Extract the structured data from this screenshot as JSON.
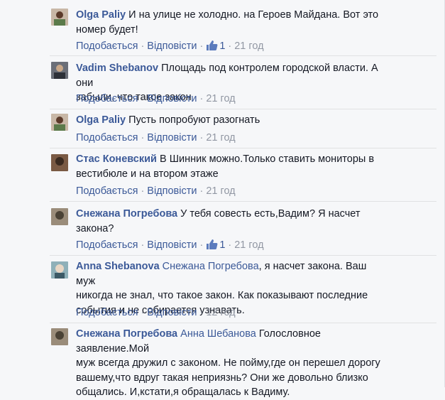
{
  "labels": {
    "like": "Подобається",
    "reply": "Відповісти",
    "sep": "·"
  },
  "comments": [
    {
      "author": "Olga Paliy",
      "mention": "",
      "text_lines": [
        "И на улице не холодно. на Героев Майдана. Вот это",
        "номер будет!"
      ],
      "likes": "1",
      "time": "21 год",
      "avatar_color": "#c8b7a6",
      "avatar_accent": "#5b7a4a"
    },
    {
      "author": "Vadim Shebanov",
      "mention": "",
      "text_lines": [
        "Площадь под контролем городской власти. А они",
        "забыли, что такое закон"
      ],
      "likes": "",
      "time": "21 год",
      "avatar_color": "#6b6f78",
      "avatar_accent": "#2d3138"
    },
    {
      "author": "Olga Paliy",
      "mention": "",
      "text_lines": [
        "Пусть попробуют разогнать"
      ],
      "likes": "",
      "time": "21 год",
      "avatar_color": "#c8b7a6",
      "avatar_accent": "#5b7a4a"
    },
    {
      "author": "Стас Коневский",
      "mention": "",
      "text_lines": [
        "В Шинник можно.Только ставить мониторы в",
        "вестибюле и на втором этаже"
      ],
      "likes": "",
      "time": "21 год",
      "avatar_color": "#7a5a44",
      "avatar_accent": "#3a2a20"
    },
    {
      "author": "Снежана Погребова",
      "mention": "",
      "text_lines": [
        "У тебя совесть есть,Вадим? Я насчет",
        "закона?"
      ],
      "likes": "1",
      "time": "21 год",
      "avatar_color": "#9a8c7a",
      "avatar_accent": "#4a4236"
    },
    {
      "author": "Anna Shebanova",
      "mention": "Снежана Погребова",
      "text_lines": [
        ", я насчет закона. Ваш муж",
        "никогда не знал, что такое закон. Как показывают последние",
        "события и не собирается узнавать."
      ],
      "likes": "",
      "time": "12 год",
      "avatar_color": "#8fb0b8",
      "avatar_accent": "#3d5a66"
    },
    {
      "author": "Снежана Погребова",
      "mention": "Анна Шебанова",
      "text_lines": [
        " Голословное заявление.Мой",
        "муж всегда дружил с законом. Не пойму,где он перешел дорогу",
        "вашему,что вдруг такая неприязнь? Они же довольно близко",
        "общались. И,кстати,я обращалась к Вадиму."
      ],
      "likes": "",
      "time": "",
      "avatar_color": "#9a8c7a",
      "avatar_accent": "#4a4236"
    }
  ]
}
